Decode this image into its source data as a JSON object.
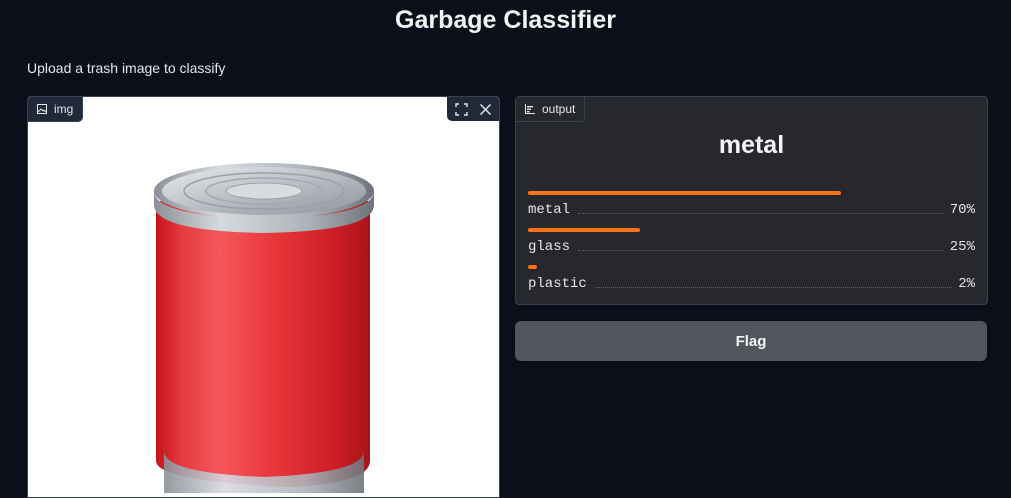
{
  "app": {
    "title": "Garbage Classifier",
    "description": "Upload a trash image to classify"
  },
  "image_input": {
    "label": "img",
    "tools": [
      "fullscreen-icon",
      "close-icon"
    ],
    "image_subject": "red tin can"
  },
  "output": {
    "label": "output",
    "top_label": "metal",
    "confidences": [
      {
        "label": "metal",
        "value": 0.7,
        "percent": "70%"
      },
      {
        "label": "glass",
        "value": 0.25,
        "percent": "25%"
      },
      {
        "label": "plastic",
        "value": 0.02,
        "percent": "2%"
      }
    ],
    "bar_color": "#f97316"
  },
  "actions": {
    "flag_label": "Flag"
  }
}
